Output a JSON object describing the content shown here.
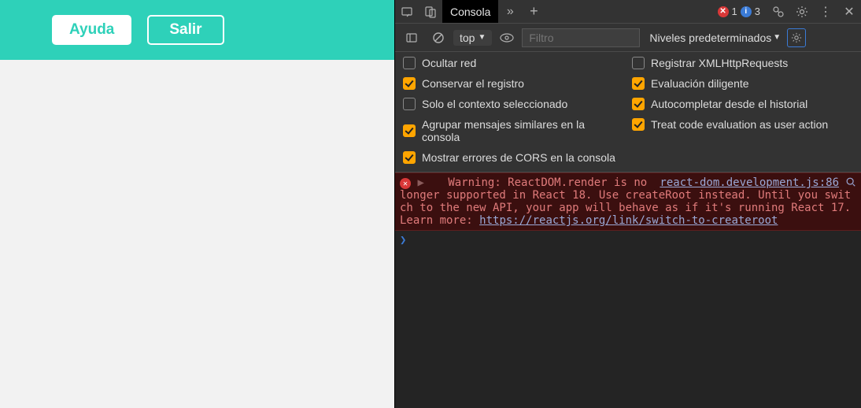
{
  "left": {
    "ayuda_label": "Ayuda",
    "salir_label": "Salir"
  },
  "tabs": {
    "console_label": "Consola"
  },
  "counters": {
    "errors": "1",
    "info": "3"
  },
  "toolbar": {
    "context_label": "top",
    "filter_placeholder": "Filtro",
    "levels_label": "Niveles predeterminados"
  },
  "settings_left": [
    {
      "label": "Ocultar red",
      "checked": false
    },
    {
      "label": "Conservar el registro",
      "checked": true
    },
    {
      "label": "Solo el contexto seleccionado",
      "checked": false
    },
    {
      "label": "Agrupar mensajes similares en la consola",
      "checked": true
    },
    {
      "label": "Mostrar errores de CORS en la consola",
      "checked": true
    }
  ],
  "settings_right": [
    {
      "label": "Registrar XMLHttpRequests",
      "checked": false
    },
    {
      "label": "Evaluación diligente",
      "checked": true
    },
    {
      "label": "Autocompletar desde el historial",
      "checked": true
    },
    {
      "label": "Treat code evaluation as user action",
      "checked": true
    }
  ],
  "error": {
    "source": "react-dom.development.js:86",
    "prefix": "Warning: ",
    "body1": "ReactDOM.render is no longer supported in React 18. Use createRoot instead. Until you switch to the new API, your app will behave as if it's running React 17. Learn more: ",
    "link": "https://reactjs.org/link/switch-to-createroot"
  }
}
